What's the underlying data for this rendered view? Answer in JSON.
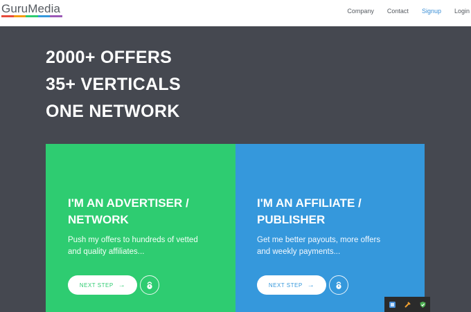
{
  "header": {
    "logo_text": "GuruMedia",
    "logo_colors": [
      "#e74c3c",
      "#f39c12",
      "#2ecc71",
      "#3498db",
      "#9b59b6"
    ],
    "nav": [
      {
        "label": "Company"
      },
      {
        "label": "Contact"
      },
      {
        "label": "Signup"
      },
      {
        "label": "Login"
      }
    ],
    "accent_color": "#3b8fd6"
  },
  "hero": {
    "lines": [
      "2000+ OFFERS",
      "35+ VERTICALS",
      "ONE NETWORK"
    ],
    "background": "#454850"
  },
  "cards": {
    "advertiser": {
      "title_line1": "I'M AN ADVERTISER /",
      "title_line2": "NETWORK",
      "desc_line1": "Push my offers to hundreds of vetted",
      "desc_line2": "and quality affiliates...",
      "button_label": "NEXT STEP",
      "button_icon": "arrow-right-icon",
      "badge_icon": "kettlebell-icon",
      "color": "#2ecc71"
    },
    "affiliate": {
      "title_line1": "I'M AN AFFILIATE /",
      "title_line2": "PUBLISHER",
      "desc_line1": "Get me better payouts, more offers",
      "desc_line2": "and weekly payments...",
      "button_label": "NEXT STEP",
      "button_icon": "arrow-right-icon",
      "badge_icon": "kettlebell-icon",
      "color": "#3598dc"
    }
  },
  "tray": {
    "icons": [
      "app-icon",
      "tool-icon",
      "shield-icon"
    ]
  }
}
